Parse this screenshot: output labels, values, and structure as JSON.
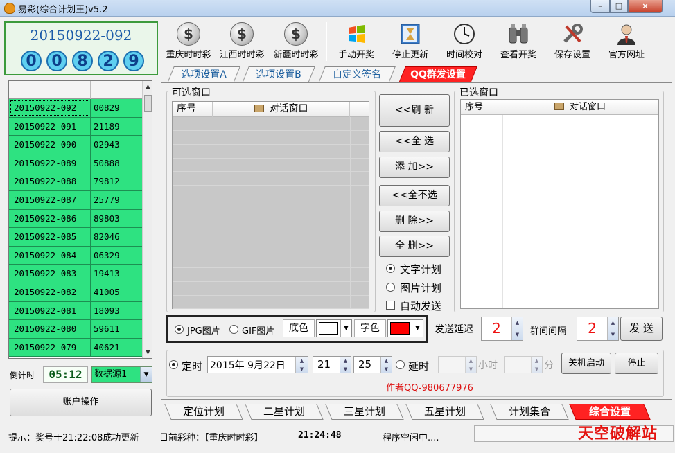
{
  "window": {
    "title": "易彩(综合计划王)v5.2",
    "min": "–",
    "max": "□",
    "close": "×"
  },
  "left": {
    "issue_number": "20150922-092",
    "balls": [
      "0",
      "0",
      "8",
      "2",
      "9"
    ],
    "history": [
      {
        "issue": "20150922-092",
        "code": "00829"
      },
      {
        "issue": "20150922-091",
        "code": "21189"
      },
      {
        "issue": "20150922-090",
        "code": "02943"
      },
      {
        "issue": "20150922-089",
        "code": "50888"
      },
      {
        "issue": "20150922-088",
        "code": "79812"
      },
      {
        "issue": "20150922-087",
        "code": "25779"
      },
      {
        "issue": "20150922-086",
        "code": "89803"
      },
      {
        "issue": "20150922-085",
        "code": "82046"
      },
      {
        "issue": "20150922-084",
        "code": "06329"
      },
      {
        "issue": "20150922-083",
        "code": "19413"
      },
      {
        "issue": "20150922-082",
        "code": "41005"
      },
      {
        "issue": "20150922-081",
        "code": "18093"
      },
      {
        "issue": "20150922-080",
        "code": "59611"
      },
      {
        "issue": "20150922-079",
        "code": "40621"
      }
    ],
    "countdown_label": "倒计时",
    "countdown_value": "05:12",
    "datasource": "数据源1",
    "account_button": "账户操作"
  },
  "toolbar": [
    {
      "label": "重庆时时彩",
      "icon": "coin-icon"
    },
    {
      "label": "江西时时彩",
      "icon": "coin-icon"
    },
    {
      "label": "新疆时时彩",
      "icon": "coin-icon"
    },
    {
      "label": "手动开奖",
      "icon": "windows-logo-icon"
    },
    {
      "label": "停止更新",
      "icon": "hourglass-icon"
    },
    {
      "label": "时间校对",
      "icon": "clock-icon"
    },
    {
      "label": "查看开奖",
      "icon": "binoculars-icon"
    },
    {
      "label": "保存设置",
      "icon": "tools-icon"
    },
    {
      "label": "官方网址",
      "icon": "user-icon"
    }
  ],
  "tabs_top": [
    "选项设置A",
    "选项设置B",
    "自定义签名",
    "QQ群发设置"
  ],
  "qq": {
    "available_title": "可选窗口",
    "selected_title": "已选窗口",
    "col_index": "序号",
    "col_window": "对话窗口",
    "buttons": {
      "refresh": "<<刷 新",
      "select_all": "<<全 选",
      "add": "添 加>>",
      "deselect_all": "<<全不选",
      "delete": "删 除>>",
      "delete_all": "全 删>>"
    },
    "text_plan": "文字计划",
    "image_plan": "图片计划",
    "auto_send": "自动发送",
    "jpg": "JPG图片",
    "gif": "GIF图片",
    "bg_label": "底色",
    "font_label": "字色",
    "bg_color": "#ffffff",
    "font_color": "#ff0000",
    "send_delay_label": "发送延迟",
    "send_delay": "2",
    "group_interval_label": "群间间隔",
    "group_interval": "2",
    "send_button": "发 送",
    "timed_label": "定时",
    "date": "2015年 9月22日",
    "hour": "21",
    "minute": "25",
    "delay_label": "延时",
    "hour_unit": "小时",
    "minute_unit": "分",
    "shutdown_button": "关机启动",
    "stop_button": "停止",
    "author": "作者QQ-980677976"
  },
  "tabs_bottom": [
    "定位计划",
    "二星计划",
    "三星计划",
    "五星计划",
    "计划集合",
    "综合设置"
  ],
  "status": {
    "tip": "提示：奖号于21:22:08成功更新",
    "lottery": "目前彩种：【重庆时时彩】",
    "time": "21:24:48",
    "state": "程序空闲中....",
    "watermark": "天空破解站"
  }
}
